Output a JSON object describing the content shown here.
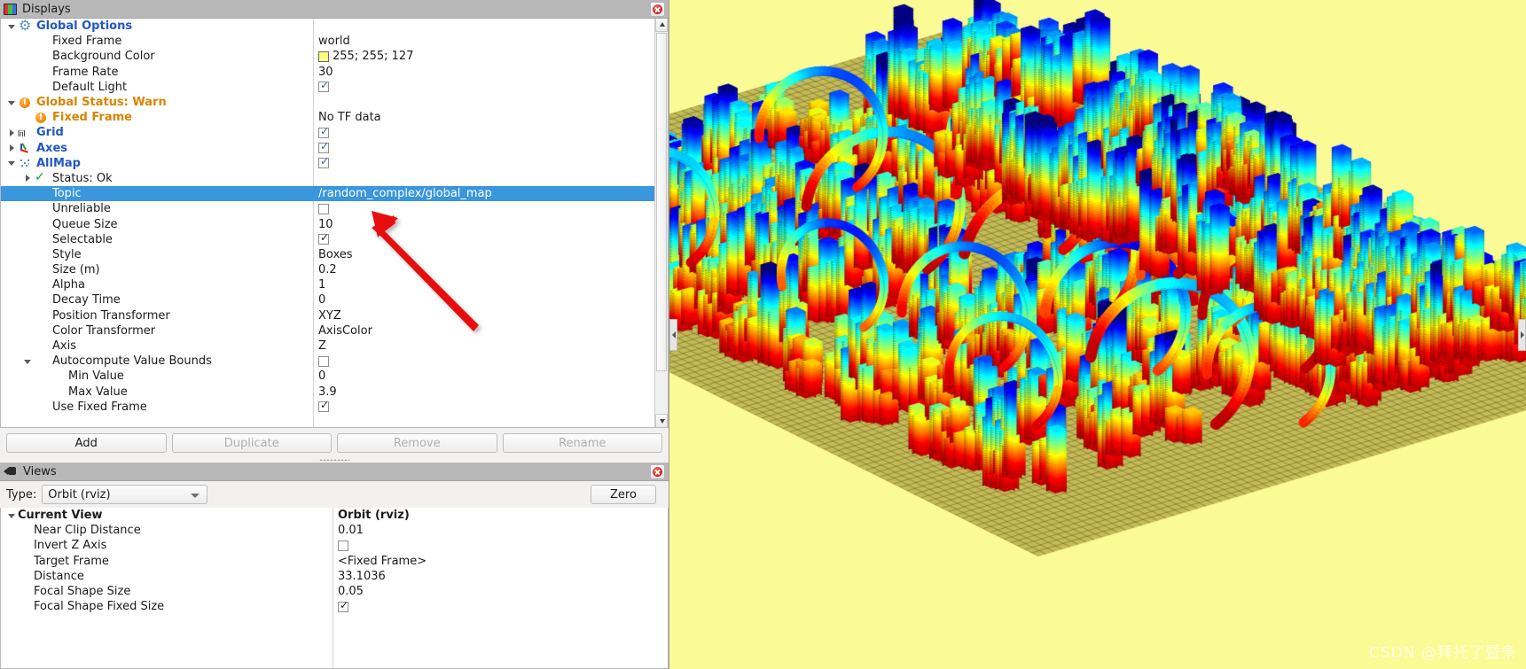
{
  "displays_panel": {
    "title": "Displays",
    "icon": "displays-icon",
    "close_icon": "close-icon",
    "rows": [
      {
        "indent": 0,
        "arrow": "down",
        "icon": "gear-icon",
        "label": "Global Options",
        "style": "blue",
        "value": "",
        "vtype": "none"
      },
      {
        "indent": 1,
        "arrow": "none",
        "icon": "none",
        "label": "Fixed Frame",
        "style": "plain",
        "value": "world",
        "vtype": "text"
      },
      {
        "indent": 1,
        "arrow": "none",
        "icon": "none",
        "label": "Background Color",
        "style": "plain",
        "value": "255; 255; 127",
        "vtype": "color",
        "color": "#ffff7f"
      },
      {
        "indent": 1,
        "arrow": "none",
        "icon": "none",
        "label": "Frame Rate",
        "style": "plain",
        "value": "30",
        "vtype": "text"
      },
      {
        "indent": 1,
        "arrow": "none",
        "icon": "none",
        "label": "Default Light",
        "style": "plain",
        "value": "",
        "vtype": "check_on"
      },
      {
        "indent": 0,
        "arrow": "down",
        "icon": "warn-icon",
        "label": "Global Status: Warn",
        "style": "warn",
        "value": "",
        "vtype": "none"
      },
      {
        "indent": 1,
        "arrow": "none",
        "icon": "warn-icon",
        "label": "Fixed Frame",
        "style": "warn",
        "value": "No TF data",
        "vtype": "text"
      },
      {
        "indent": 0,
        "arrow": "right",
        "icon": "grid-icon",
        "label": "Grid",
        "style": "blue",
        "value": "",
        "vtype": "check_on"
      },
      {
        "indent": 0,
        "arrow": "right",
        "icon": "axes-icon",
        "label": "Axes",
        "style": "blue",
        "value": "",
        "vtype": "check_on"
      },
      {
        "indent": 0,
        "arrow": "down",
        "icon": "pointcloud-icon",
        "label": "AllMap",
        "style": "blue",
        "value": "",
        "vtype": "check_on"
      },
      {
        "indent": 1,
        "arrow": "right",
        "icon": "ok-icon",
        "label": "Status: Ok",
        "style": "plain",
        "value": "",
        "vtype": "none"
      },
      {
        "indent": 1,
        "arrow": "none",
        "icon": "none",
        "label": "Topic",
        "style": "plain",
        "value": "/random_complex/global_map",
        "vtype": "text",
        "selected": true
      },
      {
        "indent": 1,
        "arrow": "none",
        "icon": "none",
        "label": "Unreliable",
        "style": "plain",
        "value": "",
        "vtype": "check_off"
      },
      {
        "indent": 1,
        "arrow": "none",
        "icon": "none",
        "label": "Queue Size",
        "style": "plain",
        "value": "10",
        "vtype": "text"
      },
      {
        "indent": 1,
        "arrow": "none",
        "icon": "none",
        "label": "Selectable",
        "style": "plain",
        "value": "",
        "vtype": "check_on_dk"
      },
      {
        "indent": 1,
        "arrow": "none",
        "icon": "none",
        "label": "Style",
        "style": "plain",
        "value": "Boxes",
        "vtype": "text"
      },
      {
        "indent": 1,
        "arrow": "none",
        "icon": "none",
        "label": "Size (m)",
        "style": "plain",
        "value": "0.2",
        "vtype": "text"
      },
      {
        "indent": 1,
        "arrow": "none",
        "icon": "none",
        "label": "Alpha",
        "style": "plain",
        "value": "1",
        "vtype": "text"
      },
      {
        "indent": 1,
        "arrow": "none",
        "icon": "none",
        "label": "Decay Time",
        "style": "plain",
        "value": "0",
        "vtype": "text"
      },
      {
        "indent": 1,
        "arrow": "none",
        "icon": "none",
        "label": "Position Transformer",
        "style": "plain",
        "value": "XYZ",
        "vtype": "text"
      },
      {
        "indent": 1,
        "arrow": "none",
        "icon": "none",
        "label": "Color Transformer",
        "style": "plain",
        "value": "AxisColor",
        "vtype": "text"
      },
      {
        "indent": 1,
        "arrow": "none",
        "icon": "none",
        "label": "Axis",
        "style": "plain",
        "value": "Z",
        "vtype": "text"
      },
      {
        "indent": 1,
        "arrow": "down",
        "icon": "none",
        "label": "Autocompute Value Bounds",
        "style": "plain",
        "value": "",
        "vtype": "check_off"
      },
      {
        "indent": 2,
        "arrow": "none",
        "icon": "none",
        "label": "Min Value",
        "style": "plain",
        "value": "0",
        "vtype": "text"
      },
      {
        "indent": 2,
        "arrow": "none",
        "icon": "none",
        "label": "Max Value",
        "style": "plain",
        "value": "3.9",
        "vtype": "text"
      },
      {
        "indent": 1,
        "arrow": "none",
        "icon": "none",
        "label": "Use Fixed Frame",
        "style": "plain",
        "value": "",
        "vtype": "check_on_dk"
      }
    ],
    "buttons": [
      {
        "label": "Add",
        "disabled": false
      },
      {
        "label": "Duplicate",
        "disabled": true
      },
      {
        "label": "Remove",
        "disabled": true
      },
      {
        "label": "Rename",
        "disabled": true
      }
    ]
  },
  "views_panel": {
    "title": "Views",
    "icon": "views-icon",
    "close_icon": "close-icon",
    "type_label": "Type:",
    "type_value": "Orbit (rviz)",
    "zero_button": "Zero",
    "rows": [
      {
        "indent": 0,
        "arrow": "down",
        "label": "Current View",
        "style": "bold",
        "value": "Orbit (rviz)",
        "vtype": "text_bold"
      },
      {
        "indent": 1,
        "arrow": "none",
        "label": "Near Clip Distance",
        "style": "plain",
        "value": "0.01",
        "vtype": "text"
      },
      {
        "indent": 1,
        "arrow": "none",
        "label": "Invert Z Axis",
        "style": "plain",
        "value": "",
        "vtype": "check_off"
      },
      {
        "indent": 1,
        "arrow": "none",
        "label": "Target Frame",
        "style": "plain",
        "value": "<Fixed Frame>",
        "vtype": "text"
      },
      {
        "indent": 1,
        "arrow": "none",
        "label": "Distance",
        "style": "plain",
        "value": "33.1036",
        "vtype": "text"
      },
      {
        "indent": 1,
        "arrow": "none",
        "label": "Focal Shape Size",
        "style": "plain",
        "value": "0.05",
        "vtype": "text"
      },
      {
        "indent": 1,
        "arrow": "none",
        "label": "Focal Shape Fixed Size",
        "style": "plain",
        "value": "",
        "vtype": "check_on_dk"
      }
    ]
  },
  "viewport": {
    "name": "3d-render-view",
    "background_color": "#fbfb96",
    "ground_color": "#c4bb55",
    "watermark": "CSDN @拜托了暨条",
    "annotation_arrow_color": "#e81010"
  }
}
